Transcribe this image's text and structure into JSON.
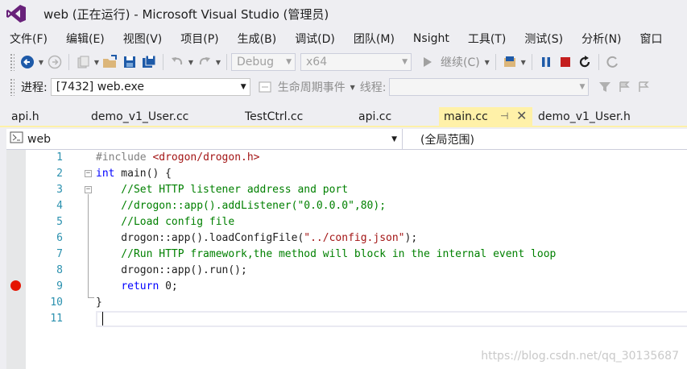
{
  "window": {
    "title": "web (正在运行) - Microsoft Visual Studio (管理员)"
  },
  "menu": [
    "文件(F)",
    "编辑(E)",
    "视图(V)",
    "项目(P)",
    "生成(B)",
    "调试(D)",
    "团队(M)",
    "Nsight",
    "工具(T)",
    "测试(S)",
    "分析(N)",
    "窗口"
  ],
  "toolbar": {
    "config": "Debug",
    "platform": "x64",
    "continue_label": "继续(C)"
  },
  "toolbar2": {
    "process_label": "进程:",
    "process_value": "[7432] web.exe",
    "lifecycle_label": "生命周期事件",
    "thread_label": "线程:"
  },
  "tabs": [
    "api.h",
    "demo_v1_User.cc",
    "TestCtrl.cc",
    "api.cc",
    "main.cc",
    "demo_v1_User.h"
  ],
  "active_tab": "main.cc",
  "navbar": {
    "project": "web",
    "scope": "(全局范围)"
  },
  "editor": {
    "line_numbers": [
      "1",
      "2",
      "3",
      "4",
      "5",
      "6",
      "7",
      "8",
      "9",
      "10",
      "11"
    ],
    "lines": {
      "l1_pp": "#include ",
      "l1_inc": "<drogon/drogon.h>",
      "l2_kw": "int",
      "l2_rest": " main() {",
      "l3": "    //Set HTTP listener address and port",
      "l4": "    //drogon::app().addListener(\"0.0.0.0\",80);",
      "l5": "    //Load config file",
      "l6_a": "    drogon::app().loadConfigFile(",
      "l6_str": "\"../config.json\"",
      "l6_b": ");",
      "l7": "    //Run HTTP framework,the method will block in the internal event loop",
      "l8": "    drogon::app().run();",
      "l9_indent": "    ",
      "l9_kw": "return",
      "l9_rest": " 0;",
      "l10": "}"
    },
    "breakpoint_line": 9
  },
  "watermark": "https://blog.csdn.net/qq_30135687",
  "colors": {
    "accent": "#68217a",
    "tab_active": "#fff1a8",
    "keyword": "#0000ff",
    "comment": "#008000",
    "string": "#a31515",
    "line_number": "#2b91af",
    "breakpoint": "#e51400"
  }
}
